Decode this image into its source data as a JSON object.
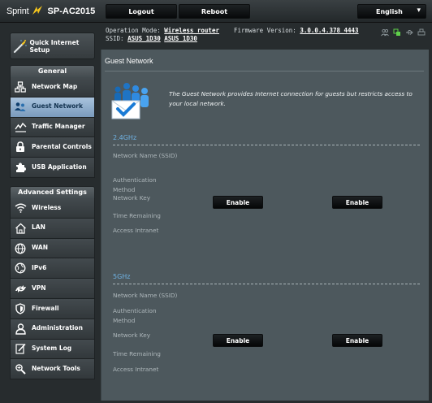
{
  "brand": {
    "carrier": "Sprint",
    "model": "SP-AC2015"
  },
  "topbar": {
    "logout": "Logout",
    "reboot": "Reboot",
    "language": "English"
  },
  "info": {
    "operation_mode_label": "Operation Mode:",
    "operation_mode_value": "Wireless router",
    "firmware_label": "Firmware Version:",
    "firmware_value": "3.0.0.4.378_4443",
    "ssid_label": "SSID:",
    "ssid_1": "ASUS_1D30",
    "ssid_2": "ASUS_1D30"
  },
  "sidebar": {
    "quick_setup": "Quick Internet Setup",
    "general_heading": "General",
    "general_items": [
      {
        "label": "Network Map",
        "icon": "network-map-icon"
      },
      {
        "label": "Guest Network",
        "icon": "guest-network-icon",
        "active": true
      },
      {
        "label": "Traffic Manager",
        "icon": "traffic-manager-icon"
      },
      {
        "label": "Parental Controls",
        "icon": "lock-icon"
      },
      {
        "label": "USB Application",
        "icon": "puzzle-icon"
      }
    ],
    "advanced_heading": "Advanced Settings",
    "advanced_items": [
      {
        "label": "Wireless",
        "icon": "wifi-icon"
      },
      {
        "label": "LAN",
        "icon": "home-icon"
      },
      {
        "label": "WAN",
        "icon": "globe-icon"
      },
      {
        "label": "IPv6",
        "icon": "ipv6-globe-icon"
      },
      {
        "label": "VPN",
        "icon": "vpn-icon"
      },
      {
        "label": "Firewall",
        "icon": "shield-icon"
      },
      {
        "label": "Administration",
        "icon": "admin-user-icon"
      },
      {
        "label": "System Log",
        "icon": "system-log-icon"
      },
      {
        "label": "Network Tools",
        "icon": "network-tools-icon"
      }
    ]
  },
  "main": {
    "title": "Guest Network",
    "description": "The Guest Network provides Internet connection for guests but restricts access to your local network.",
    "bands": [
      {
        "name": "2.4GHz",
        "fields": [
          "Network Name (SSID)",
          "Authentication Method",
          "Network Key",
          "Time Remaining",
          "Access Intranet"
        ],
        "buttons": [
          "Enable",
          "Enable"
        ]
      },
      {
        "name": "5GHz",
        "fields": [
          "Network Name (SSID)",
          "Authentication Method",
          "Network Key",
          "Time Remaining",
          "Access Intranet"
        ],
        "buttons": [
          "Enable",
          "Enable"
        ]
      }
    ]
  },
  "colors": {
    "accent": "#6fb2e3",
    "active_menu": "#8fb0d0",
    "panel": "#4d585d",
    "brand_yellow": "#f6c61d"
  }
}
